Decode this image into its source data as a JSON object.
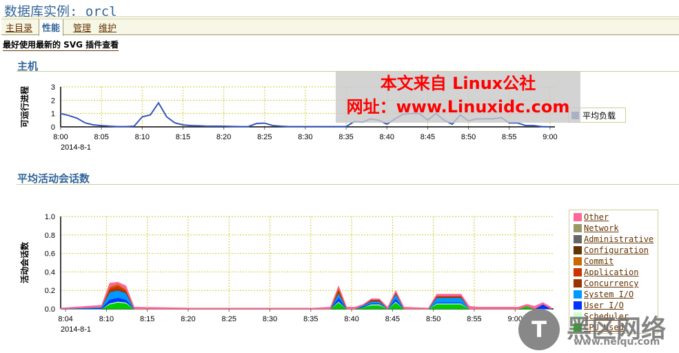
{
  "title": "数据库实例: orcl",
  "tabs": [
    {
      "label": "主目录",
      "active": false
    },
    {
      "label": "性能",
      "active": true
    },
    {
      "label": "管理",
      "active": false
    },
    {
      "label": "维护",
      "active": false
    }
  ],
  "svg_note": "最好使用最新的 SVG 插件查看",
  "sections": {
    "host": "主机",
    "sessions": "平均活动会话数"
  },
  "watermark": {
    "line1": "本文来自 Linux公社",
    "line2": "网址：www.Linuxidc.com",
    "corner": "黑区网络",
    "corner_url": "www.heiqu.com"
  },
  "chart_data": [
    {
      "type": "line",
      "ylabel": "可运行进程",
      "date_label": "2014-8-1",
      "ylim": [
        0,
        3
      ],
      "yticks": [
        "0",
        "1",
        "2",
        "3"
      ],
      "xticks": [
        "8:00",
        "8:05",
        "8:10",
        "8:15",
        "8:20",
        "8:25",
        "8:30",
        "8:35",
        "8:40",
        "8:45",
        "8:50",
        "8:55",
        "9:00"
      ],
      "grid": true,
      "legend": "right",
      "color": "#3355bb",
      "series": [
        {
          "name": "平均负载",
          "x_minutes_after_8_00": [
            0,
            1,
            2,
            3,
            4,
            5,
            6,
            7,
            8,
            9,
            10,
            11,
            12,
            13,
            14,
            15,
            16,
            17,
            18,
            19,
            20,
            21,
            22,
            23,
            24,
            25,
            26,
            27,
            28,
            30,
            32,
            34,
            35,
            36,
            37,
            38,
            39,
            40,
            41,
            42,
            43,
            44,
            45,
            46,
            47,
            48,
            49,
            50,
            51,
            52,
            53,
            54,
            55,
            56,
            57,
            58,
            59,
            60
          ],
          "values": [
            1.0,
            0.85,
            0.65,
            0.3,
            0.15,
            0.1,
            0.05,
            0.02,
            0.02,
            0.05,
            0.75,
            0.9,
            1.8,
            0.75,
            0.3,
            0.15,
            0.1,
            0.08,
            0.05,
            0.05,
            0.05,
            0.03,
            0.02,
            0.02,
            0.25,
            0.28,
            0.1,
            0.05,
            0.02,
            0.02,
            0.02,
            0.02,
            0.02,
            0.4,
            0.35,
            0.6,
            0.5,
            0.2,
            0.6,
            0.95,
            1.0,
            1.0,
            0.5,
            1.0,
            0.5,
            0.2,
            0.9,
            0.45,
            0.6,
            0.6,
            0.6,
            0.7,
            0.3,
            0.3,
            0.1,
            0.1,
            0.02,
            0.0
          ]
        }
      ]
    },
    {
      "type": "area",
      "stacked": true,
      "ylabel": "活动会话数",
      "date_label": "2014-8-1",
      "ylim": [
        0,
        1.0
      ],
      "yticks": [
        "0.0",
        "0.2",
        "0.4",
        "0.6",
        "0.8",
        "1.0"
      ],
      "xticks": [
        "8:04",
        "8:10",
        "8:15",
        "8:20",
        "8:25",
        "8:30",
        "8:35",
        "8:40",
        "8:45",
        "8:50",
        "8:55",
        "9:00"
      ],
      "grid": true,
      "legend": "right",
      "x_minutes_after_8_00": [
        4,
        9,
        10,
        11,
        12,
        13,
        20,
        35,
        37,
        38,
        39,
        40,
        41,
        42,
        43,
        44,
        45,
        46,
        49,
        50,
        53,
        54,
        55,
        60,
        61,
        62,
        63,
        64
      ],
      "series": [
        {
          "name": "CPU Used",
          "color": "#00cc00",
          "values": [
            0,
            0,
            0.05,
            0.07,
            0.06,
            0,
            0,
            0,
            0,
            0.07,
            0,
            0,
            0.02,
            0.04,
            0.04,
            0,
            0.07,
            0,
            0,
            0.05,
            0.05,
            0,
            0,
            0,
            0.03,
            0,
            0,
            0
          ]
        },
        {
          "name": "Scheduler",
          "color": "#ccffcc",
          "values": [
            0,
            0,
            0.01,
            0.01,
            0.01,
            0,
            0,
            0,
            0,
            0.01,
            0,
            0,
            0,
            0.01,
            0.01,
            0,
            0.01,
            0,
            0,
            0.01,
            0.01,
            0,
            0,
            0,
            0,
            0,
            0,
            0
          ]
        },
        {
          "name": "User I/O",
          "color": "#0033ff",
          "values": [
            0,
            0.01,
            0.04,
            0.04,
            0.03,
            0,
            0,
            0,
            0,
            0.04,
            0,
            0,
            0.01,
            0.01,
            0.01,
            0,
            0.03,
            0,
            0,
            0.01,
            0.01,
            0,
            0,
            0,
            0,
            0,
            0.05,
            0
          ]
        },
        {
          "name": "System I/O",
          "color": "#0099ff",
          "values": [
            0,
            0.01,
            0.08,
            0.08,
            0.07,
            0,
            0,
            0,
            0,
            0.05,
            0,
            0,
            0.01,
            0.02,
            0.02,
            0,
            0.05,
            0,
            0,
            0.05,
            0.05,
            0,
            0,
            0,
            0,
            0,
            0,
            0
          ]
        },
        {
          "name": "Concurrency",
          "color": "#993300",
          "values": [
            0,
            0,
            0.02,
            0.02,
            0.01,
            0,
            0,
            0,
            0,
            0.02,
            0,
            0,
            0,
            0.01,
            0.01,
            0,
            0.01,
            0,
            0,
            0.01,
            0.01,
            0,
            0,
            0,
            0,
            0,
            0,
            0
          ]
        },
        {
          "name": "Application",
          "color": "#cc3300",
          "values": [
            0,
            0,
            0.02,
            0.03,
            0.02,
            0,
            0,
            0,
            0,
            0.02,
            0,
            0,
            0,
            0.01,
            0.01,
            0,
            0.01,
            0,
            0,
            0.01,
            0.01,
            0,
            0,
            0,
            0,
            0,
            0,
            0
          ]
        },
        {
          "name": "Commit",
          "color": "#cc6600",
          "values": [
            0,
            0,
            0.02,
            0.02,
            0.01,
            0,
            0,
            0,
            0,
            0.02,
            0,
            0,
            0,
            0,
            0,
            0,
            0,
            0,
            0,
            0,
            0,
            0,
            0,
            0,
            0,
            0,
            0,
            0
          ]
        },
        {
          "name": "Configuration",
          "color": "#663300",
          "values": [
            0,
            0,
            0,
            0,
            0,
            0,
            0,
            0,
            0,
            0,
            0,
            0,
            0,
            0,
            0,
            0,
            0,
            0,
            0,
            0,
            0,
            0,
            0,
            0,
            0,
            0,
            0,
            0
          ]
        },
        {
          "name": "Administrative",
          "color": "#666666",
          "values": [
            0,
            0,
            0,
            0,
            0,
            0,
            0,
            0,
            0,
            0,
            0,
            0,
            0,
            0,
            0,
            0,
            0,
            0,
            0,
            0,
            0,
            0,
            0,
            0,
            0,
            0,
            0,
            0
          ]
        },
        {
          "name": "Network",
          "color": "#999966",
          "values": [
            0,
            0,
            0,
            0,
            0,
            0,
            0,
            0,
            0,
            0,
            0,
            0,
            0,
            0,
            0,
            0,
            0,
            0,
            0,
            0,
            0,
            0,
            0,
            0,
            0,
            0,
            0,
            0
          ]
        },
        {
          "name": "Other",
          "color": "#ff6699",
          "values": [
            0.01,
            0.02,
            0.04,
            0.02,
            0.04,
            0.02,
            0.01,
            0.01,
            0.02,
            0.02,
            0.02,
            0.02,
            0.01,
            0.01,
            0.01,
            0.02,
            0.02,
            0.02,
            0.01,
            0.02,
            0.02,
            0.03,
            0.02,
            0.02,
            0.02,
            0.03,
            0.02,
            0.02
          ]
        }
      ]
    }
  ]
}
